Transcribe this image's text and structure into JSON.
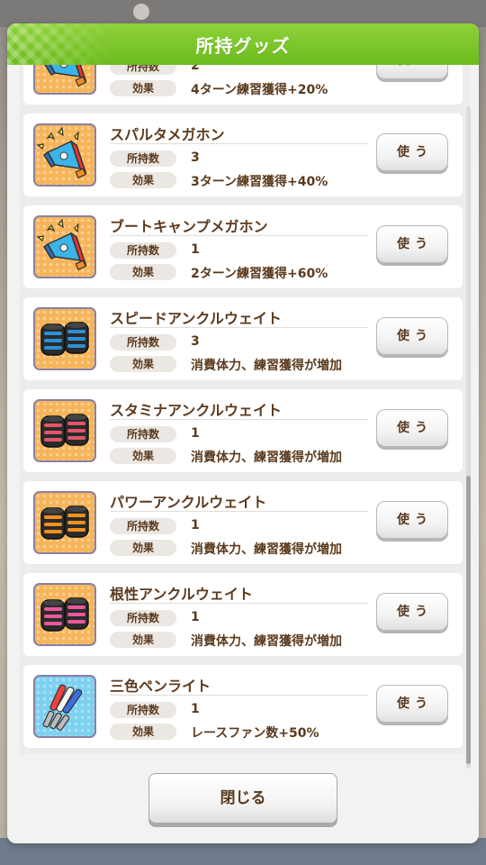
{
  "modal": {
    "title": "所持グッズ",
    "close_label": "閉じる",
    "accent": "#7ac62a"
  },
  "labels": {
    "owned": "所持数",
    "effect": "効果",
    "use": "使う"
  },
  "items": [
    {
      "name": "",
      "owned": "2",
      "effect": "4ターン練習獲得+20%",
      "icon": "megaphone-yellow-icon"
    },
    {
      "name": "スパルタメガホン",
      "owned": "3",
      "effect": "3ターン練習獲得+40%",
      "icon": "megaphone-yellow-icon"
    },
    {
      "name": "ブートキャンプメガホン",
      "owned": "1",
      "effect": "2ターン練習獲得+60%",
      "icon": "megaphone-yellow-icon"
    },
    {
      "name": "スピードアンクルウェイト",
      "owned": "3",
      "effect": "消費体力、練習獲得が増加",
      "icon": "ankle-weight-blue-icon",
      "stripe": "#2e8fd8"
    },
    {
      "name": "スタミナアンクルウェイト",
      "owned": "1",
      "effect": "消費体力、練習獲得が増加",
      "icon": "ankle-weight-red-icon",
      "stripe": "#e0566a"
    },
    {
      "name": "パワーアンクルウェイト",
      "owned": "1",
      "effect": "消費体力、練習獲得が増加",
      "icon": "ankle-weight-orange-icon",
      "stripe": "#f09020"
    },
    {
      "name": "根性アンクルウェイト",
      "owned": "1",
      "effect": "消費体力、練習獲得が増加",
      "icon": "ankle-weight-pink-icon",
      "stripe": "#e8589a"
    },
    {
      "name": "三色ペンライト",
      "owned": "1",
      "effect": "レースファン数+50%",
      "icon": "penlight-icon"
    }
  ]
}
